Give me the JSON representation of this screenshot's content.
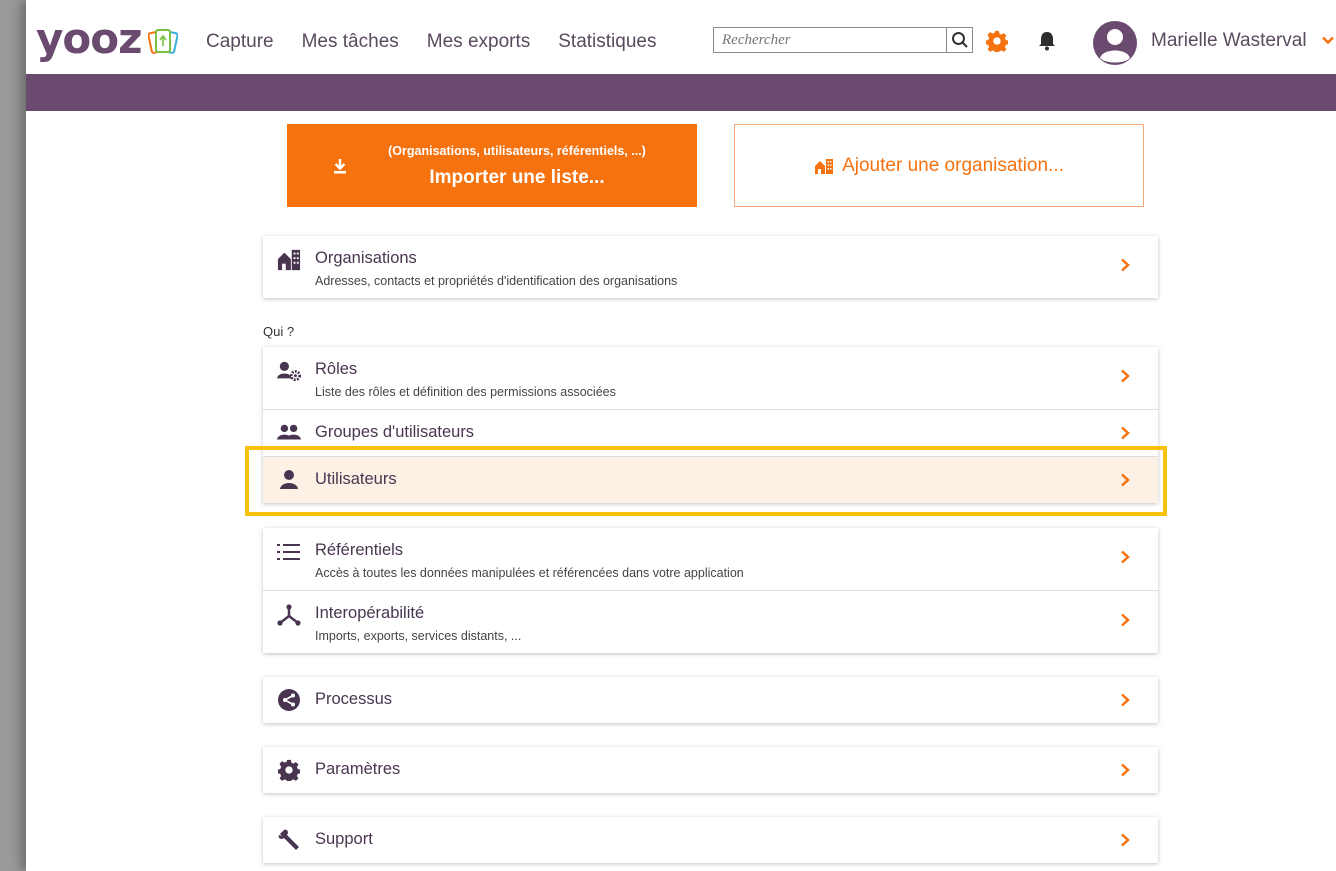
{
  "brand": {
    "logo_text": "yooz",
    "logo_color": "#6b4a6f"
  },
  "header": {
    "nav": [
      "Capture",
      "Mes tâches",
      "Mes exports",
      "Statistiques"
    ],
    "search_placeholder": "Rechercher",
    "user_name": "Marielle Wasterval"
  },
  "colors": {
    "accent": "#f5720f",
    "purple": "#6b4a6f",
    "highlight": "#f7c20c"
  },
  "actions": {
    "import_sub": "(Organisations, utilisateurs, référentiels, ...)",
    "import_label": "Importer une liste...",
    "add_org_label": "Ajouter une organisation..."
  },
  "sections": {
    "organisations": {
      "title": "Organisations",
      "desc": "Adresses, contacts et propriétés d'identification des organisations"
    },
    "qui_label": "Qui ?",
    "roles": {
      "title": "Rôles",
      "desc": "Liste des rôles et définition des permissions associées"
    },
    "groupes": {
      "title": "Groupes d'utilisateurs"
    },
    "utilisateurs": {
      "title": "Utilisateurs"
    },
    "referentiels": {
      "title": "Référentiels",
      "desc": "Accès à toutes les données manipulées et référencées dans votre application"
    },
    "interop": {
      "title": "Interopérabilité",
      "desc": "Imports, exports, services distants, ..."
    },
    "processus": {
      "title": "Processus"
    },
    "parametres": {
      "title": "Paramètres"
    },
    "support": {
      "title": "Support"
    }
  }
}
